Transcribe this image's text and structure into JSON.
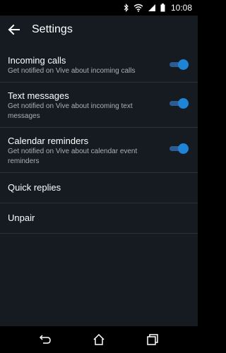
{
  "status_bar": {
    "time": "10:08",
    "icons": [
      "bluetooth-icon",
      "wifi-icon",
      "signal-icon",
      "battery-icon"
    ]
  },
  "app_bar": {
    "title": "Settings",
    "back_icon": "arrow-back-icon"
  },
  "settings": [
    {
      "title": "Incoming calls",
      "description": "Get notified on Vive about incoming calls",
      "enabled": true
    },
    {
      "title": "Text messages",
      "description": "Get notified on Vive about incoming text messages",
      "enabled": true
    },
    {
      "title": "Calendar reminders",
      "description": "Get notified on Vive about calendar event reminders",
      "enabled": true
    }
  ],
  "menu_items": [
    {
      "title": "Quick replies"
    },
    {
      "title": "Unpair"
    }
  ],
  "nav_bar": {
    "icons": [
      "back-nav-icon",
      "home-nav-icon",
      "recents-nav-icon"
    ]
  },
  "colors": {
    "background": "#161b21",
    "accent": "#1f83d6",
    "divider": "#2b3138"
  }
}
